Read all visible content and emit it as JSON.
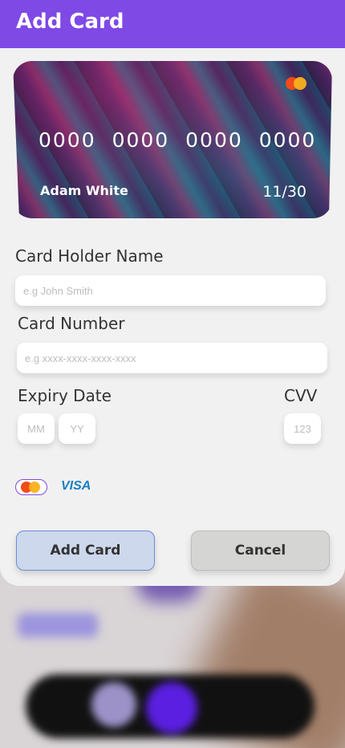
{
  "header": {
    "title": "Add Card"
  },
  "card_preview": {
    "number": "0000 0000 0000 0000",
    "holder": "Adam White",
    "expiry": "11/30",
    "logo_icon": "mastercard-icon"
  },
  "form": {
    "holder_label": "Card Holder Name",
    "holder_placeholder": "e.g John Smith",
    "number_label": "Card Number",
    "number_placeholder": "e.g xxxx-xxxx-xxxx-xxxx",
    "expiry_label": "Expiry Date",
    "month_placeholder": "MM",
    "year_placeholder": "YY",
    "cvv_label": "CVV",
    "cvv_placeholder": "123"
  },
  "brands": {
    "mastercard_icon": "mastercard-icon",
    "visa_label": "VISA",
    "selected": "mastercard"
  },
  "actions": {
    "add_label": "Add Card",
    "cancel_label": "Cancel"
  },
  "colors": {
    "accent": "#7f49e6",
    "add_button": "#cdd8ec",
    "cancel_button": "#d5d5d3"
  }
}
